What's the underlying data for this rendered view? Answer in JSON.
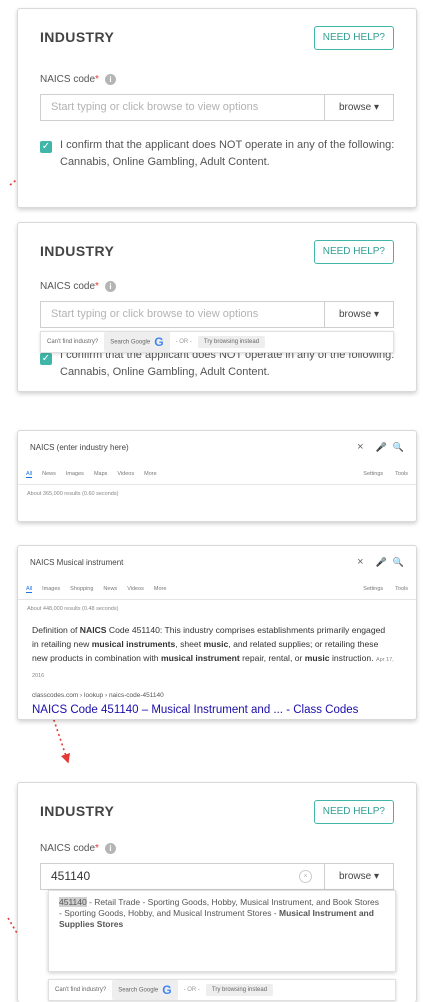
{
  "industry_form": {
    "title": "INDUSTRY",
    "help_label": "NEED HELP?",
    "naics_label": "NAICS code",
    "required_mark": "*",
    "info_glyph": "i",
    "placeholder": "Start typing or click browse to view options",
    "browse_label": "browse ▾",
    "checkbox_glyph": "✓",
    "confirm_text": "I confirm that the applicant does NOT operate in any of the following: Cannabis, Online Gambling, Adult Content."
  },
  "cant_find": {
    "prompt": "Can't find industry?",
    "search_label": "Search Google",
    "or_label": "- OR -",
    "browse_label": "Try browsing instead",
    "google_glyph": "G"
  },
  "search_one": {
    "query": "NAICS (enter industry here)",
    "tabs": [
      "All",
      "News",
      "Images",
      "Maps",
      "Videos",
      "More"
    ],
    "settings": "Settings",
    "tools": "Tools",
    "results_count": "About 365,000 results (0.60 seconds)"
  },
  "search_two": {
    "query": "NAICS Musical instrument",
    "tabs": [
      "All",
      "Images",
      "Shopping",
      "News",
      "Videos",
      "More"
    ],
    "settings": "Settings",
    "tools": "Tools",
    "results_count": "About 448,000 results (0.48 seconds)",
    "snippet_prefix": "Definition of",
    "snippet_bold1": "NAICS",
    "snippet_mid1": "Code 451140: This industry comprises establishments primarily engaged in retailing new",
    "snippet_bold2": "musical instruments",
    "snippet_mid2": ", sheet",
    "snippet_bold3": "music",
    "snippet_mid3": ", and related supplies; or retailing these new products in combination with",
    "snippet_bold4": "musical instrument",
    "snippet_mid4": "repair, rental, or",
    "snippet_bold5": "music",
    "snippet_end": "instruction.",
    "date": "Apr 17, 2016",
    "cite": "classcodes.com › lookup › naics-code-451140",
    "result_title": "NAICS Code 451140 – Musical Instrument and ... - Class Codes"
  },
  "filled_form": {
    "value": "451140",
    "clear_glyph": "×",
    "suggestion_code": "451140",
    "suggestion_text": " - Retail Trade - Sporting Goods, Hobby, Musical Instrument, and Book Stores - Sporting Goods, Hobby, and Musical Instrument Stores - ",
    "suggestion_bold": "Musical Instrument and Supplies Stores"
  },
  "icons": {
    "close": "×",
    "mic": "🎤",
    "search": "🔍"
  },
  "colors": {
    "accent": "#3fb6a8",
    "required": "#e53935",
    "link": "#1a0dab",
    "arrow": "#e53935"
  }
}
